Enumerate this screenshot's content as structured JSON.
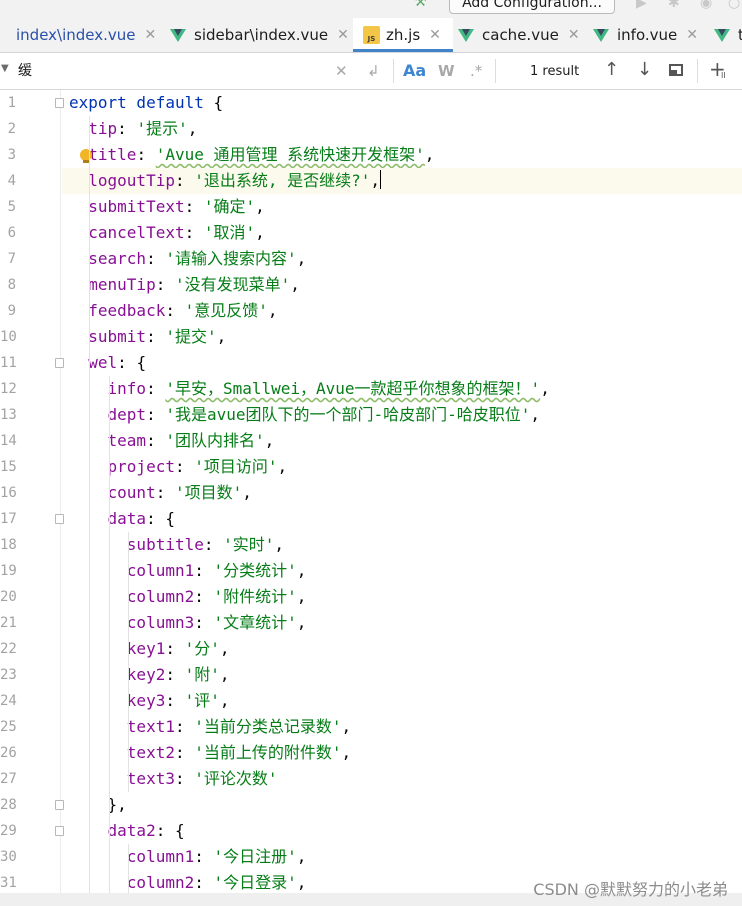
{
  "toolbar": {
    "add_configuration_label": "Add Configuration..."
  },
  "tabs": [
    {
      "label": "index\\index.vue",
      "icon": "vue-icon",
      "active": false
    },
    {
      "label": "sidebar\\index.vue",
      "icon": "vue-icon",
      "active": false
    },
    {
      "label": "zh.js",
      "icon": "js-file-icon",
      "icon_text": "JS",
      "active": true
    },
    {
      "label": "cache.vue",
      "icon": "vue-icon",
      "active": false
    },
    {
      "label": "info.vue",
      "icon": "vue-icon",
      "active": false
    },
    {
      "label": "t",
      "icon": "vue-icon",
      "active": false
    }
  ],
  "find": {
    "query": "缓",
    "match_case_label": "Aa",
    "words_label": "W",
    "regex_label": ".*",
    "result_text": "1 result"
  },
  "editor": {
    "current_line": 4,
    "lines": [
      {
        "n": "1",
        "tokens": [
          [
            "kw",
            "export default "
          ],
          [
            "pun",
            "{"
          ]
        ]
      },
      {
        "n": "2",
        "tokens": [
          [
            "pun",
            "  "
          ],
          [
            "key",
            "tip"
          ],
          [
            "pun",
            ": "
          ],
          [
            "str",
            "'提示'"
          ],
          [
            "pun",
            ","
          ]
        ]
      },
      {
        "n": "3",
        "tokens": [
          [
            "pun",
            "  "
          ],
          [
            "key",
            "title"
          ],
          [
            "pun",
            ": "
          ],
          [
            "str",
            "'Avue 通用管理 系统快速开发框架'"
          ],
          [
            "pun",
            ","
          ]
        ]
      },
      {
        "n": "4",
        "tokens": [
          [
            "pun",
            "  "
          ],
          [
            "key",
            "logoutTip"
          ],
          [
            "pun",
            ": "
          ],
          [
            "str",
            "'退出系统, 是否继续?'"
          ],
          [
            "pun",
            ","
          ]
        ]
      },
      {
        "n": "5",
        "tokens": [
          [
            "pun",
            "  "
          ],
          [
            "key",
            "submitText"
          ],
          [
            "pun",
            ": "
          ],
          [
            "str",
            "'确定'"
          ],
          [
            "pun",
            ","
          ]
        ]
      },
      {
        "n": "6",
        "tokens": [
          [
            "pun",
            "  "
          ],
          [
            "key",
            "cancelText"
          ],
          [
            "pun",
            ": "
          ],
          [
            "str",
            "'取消'"
          ],
          [
            "pun",
            ","
          ]
        ]
      },
      {
        "n": "7",
        "tokens": [
          [
            "pun",
            "  "
          ],
          [
            "key",
            "search"
          ],
          [
            "pun",
            ": "
          ],
          [
            "str",
            "'请输入搜索内容'"
          ],
          [
            "pun",
            ","
          ]
        ]
      },
      {
        "n": "8",
        "tokens": [
          [
            "pun",
            "  "
          ],
          [
            "key",
            "menuTip"
          ],
          [
            "pun",
            ": "
          ],
          [
            "str",
            "'没有发现菜单'"
          ],
          [
            "pun",
            ","
          ]
        ]
      },
      {
        "n": "9",
        "tokens": [
          [
            "pun",
            "  "
          ],
          [
            "key",
            "feedback"
          ],
          [
            "pun",
            ": "
          ],
          [
            "str",
            "'意见反馈'"
          ],
          [
            "pun",
            ","
          ]
        ]
      },
      {
        "n": "10",
        "tokens": [
          [
            "pun",
            "  "
          ],
          [
            "key",
            "submit"
          ],
          [
            "pun",
            ": "
          ],
          [
            "str",
            "'提交'"
          ],
          [
            "pun",
            ","
          ]
        ]
      },
      {
        "n": "11",
        "tokens": [
          [
            "pun",
            "  "
          ],
          [
            "key",
            "wel"
          ],
          [
            "pun",
            ": {"
          ]
        ]
      },
      {
        "n": "12",
        "tokens": [
          [
            "pun",
            "    "
          ],
          [
            "key",
            "info"
          ],
          [
            "pun",
            ": "
          ],
          [
            "str",
            "'早安，Smallwei，Avue一款超乎你想象的框架！'"
          ],
          [
            "pun",
            ","
          ]
        ]
      },
      {
        "n": "13",
        "tokens": [
          [
            "pun",
            "    "
          ],
          [
            "key",
            "dept"
          ],
          [
            "pun",
            ": "
          ],
          [
            "str",
            "'我是avue团队下的一个部门-哈皮部门-哈皮职位'"
          ],
          [
            "pun",
            ","
          ]
        ]
      },
      {
        "n": "14",
        "tokens": [
          [
            "pun",
            "    "
          ],
          [
            "key",
            "team"
          ],
          [
            "pun",
            ": "
          ],
          [
            "str",
            "'团队内排名'"
          ],
          [
            "pun",
            ","
          ]
        ]
      },
      {
        "n": "15",
        "tokens": [
          [
            "pun",
            "    "
          ],
          [
            "key",
            "project"
          ],
          [
            "pun",
            ": "
          ],
          [
            "str",
            "'项目访问'"
          ],
          [
            "pun",
            ","
          ]
        ]
      },
      {
        "n": "16",
        "tokens": [
          [
            "pun",
            "    "
          ],
          [
            "key",
            "count"
          ],
          [
            "pun",
            ": "
          ],
          [
            "str",
            "'项目数'"
          ],
          [
            "pun",
            ","
          ]
        ]
      },
      {
        "n": "17",
        "tokens": [
          [
            "pun",
            "    "
          ],
          [
            "key",
            "data"
          ],
          [
            "pun",
            ": {"
          ]
        ]
      },
      {
        "n": "18",
        "tokens": [
          [
            "pun",
            "      "
          ],
          [
            "key",
            "subtitle"
          ],
          [
            "pun",
            ": "
          ],
          [
            "str",
            "'实时'"
          ],
          [
            "pun",
            ","
          ]
        ]
      },
      {
        "n": "19",
        "tokens": [
          [
            "pun",
            "      "
          ],
          [
            "key",
            "column1"
          ],
          [
            "pun",
            ": "
          ],
          [
            "str",
            "'分类统计'"
          ],
          [
            "pun",
            ","
          ]
        ]
      },
      {
        "n": "20",
        "tokens": [
          [
            "pun",
            "      "
          ],
          [
            "key",
            "column2"
          ],
          [
            "pun",
            ": "
          ],
          [
            "str",
            "'附件统计'"
          ],
          [
            "pun",
            ","
          ]
        ]
      },
      {
        "n": "21",
        "tokens": [
          [
            "pun",
            "      "
          ],
          [
            "key",
            "column3"
          ],
          [
            "pun",
            ": "
          ],
          [
            "str",
            "'文章统计'"
          ],
          [
            "pun",
            ","
          ]
        ]
      },
      {
        "n": "22",
        "tokens": [
          [
            "pun",
            "      "
          ],
          [
            "key",
            "key1"
          ],
          [
            "pun",
            ": "
          ],
          [
            "str",
            "'分'"
          ],
          [
            "pun",
            ","
          ]
        ]
      },
      {
        "n": "23",
        "tokens": [
          [
            "pun",
            "      "
          ],
          [
            "key",
            "key2"
          ],
          [
            "pun",
            ": "
          ],
          [
            "str",
            "'附'"
          ],
          [
            "pun",
            ","
          ]
        ]
      },
      {
        "n": "24",
        "tokens": [
          [
            "pun",
            "      "
          ],
          [
            "key",
            "key3"
          ],
          [
            "pun",
            ": "
          ],
          [
            "str",
            "'评'"
          ],
          [
            "pun",
            ","
          ]
        ]
      },
      {
        "n": "25",
        "tokens": [
          [
            "pun",
            "      "
          ],
          [
            "key",
            "text1"
          ],
          [
            "pun",
            ": "
          ],
          [
            "str",
            "'当前分类总记录数'"
          ],
          [
            "pun",
            ","
          ]
        ]
      },
      {
        "n": "26",
        "tokens": [
          [
            "pun",
            "      "
          ],
          [
            "key",
            "text2"
          ],
          [
            "pun",
            ": "
          ],
          [
            "str",
            "'当前上传的附件数'"
          ],
          [
            "pun",
            ","
          ]
        ]
      },
      {
        "n": "27",
        "tokens": [
          [
            "pun",
            "      "
          ],
          [
            "key",
            "text3"
          ],
          [
            "pun",
            ": "
          ],
          [
            "str",
            "'评论次数'"
          ]
        ]
      },
      {
        "n": "28",
        "tokens": [
          [
            "pun",
            "    },"
          ]
        ]
      },
      {
        "n": "29",
        "tokens": [
          [
            "pun",
            "    "
          ],
          [
            "key",
            "data2"
          ],
          [
            "pun",
            ": {"
          ]
        ]
      },
      {
        "n": "30",
        "tokens": [
          [
            "pun",
            "      "
          ],
          [
            "key",
            "column1"
          ],
          [
            "pun",
            ": "
          ],
          [
            "str",
            "'今日注册'"
          ],
          [
            "pun",
            ","
          ]
        ]
      },
      {
        "n": "31",
        "tokens": [
          [
            "pun",
            "      "
          ],
          [
            "key",
            "column2"
          ],
          [
            "pun",
            ": "
          ],
          [
            "str",
            "'今日登录'"
          ],
          [
            "pun",
            ","
          ]
        ]
      }
    ]
  },
  "watermark": "CSDN @默默努力的小老弟",
  "colors": {
    "keyword": "#0033b3",
    "property": "#871094",
    "string": "#067d17",
    "active_tab_underline": "#4083c9"
  }
}
